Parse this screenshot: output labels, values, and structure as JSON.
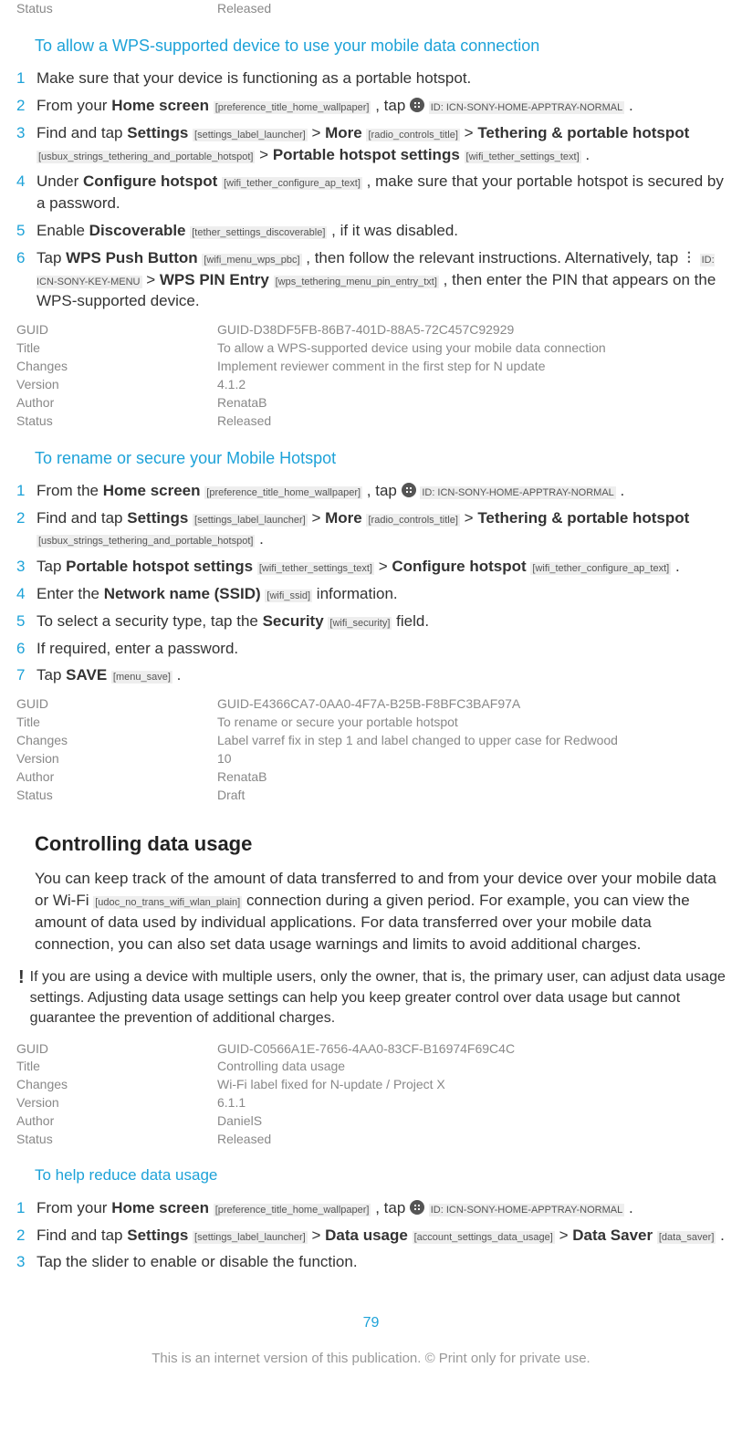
{
  "topmeta": {
    "status_k": "Status",
    "status_v": "Released"
  },
  "sec1": {
    "title": "To allow a WPS-supported device to use your mobile data connection",
    "s1": "Make sure that your device is functioning as a portable hotspot.",
    "s2a": "From your ",
    "s2_home": "Home screen",
    "s2_home_tag": "[preference_title_home_wallpaper]",
    "s2b": " , tap ",
    "s2_icon_tag": "ID: ICN-SONY-HOME-APPTRAY-NORMAL",
    "s2c": " .",
    "s3a": "Find and tap ",
    "s3_settings": "Settings",
    "s3_settings_tag": "[settings_label_launcher]",
    "s3_more": "More",
    "s3_more_tag": "[radio_controls_title]",
    "s3_th": "Tethering & portable hotspot",
    "s3_th_tag": "[usbux_strings_tethering_and_portable_hotspot]",
    "s3_phs": "Portable hotspot settings",
    "s3_phs_tag": "[wifi_tether_settings_text]",
    "s4a": "Under ",
    "s4_cfg": "Configure hotspot",
    "s4_cfg_tag": "[wifi_tether_configure_ap_text]",
    "s4b": " , make sure that your portable hotspot is secured by a password.",
    "s5a": "Enable ",
    "s5_disc": "Discoverable",
    "s5_disc_tag": "[tether_settings_discoverable]",
    "s5b": " , if it was disabled.",
    "s6a": "Tap ",
    "s6_wps": "WPS Push Button",
    "s6_wps_tag": "[wifi_menu_wps_pbc]",
    "s6b": " , then follow the relevant instructions. Alternatively, tap ",
    "s6_icon_tag": "ID: ICN-SONY-KEY-MENU",
    "s6_pin": "WPS PIN Entry",
    "s6_pin_tag": "[wps_tethering_menu_pin_entry_txt]",
    "s6c": " , then enter the PIN that appears on the WPS-supported device."
  },
  "meta1": {
    "guid_k": "GUID",
    "guid_v": "GUID-D38DF5FB-86B7-401D-88A5-72C457C92929",
    "title_k": "Title",
    "title_v": "To allow a WPS-supported device using your mobile data connection",
    "changes_k": "Changes",
    "changes_v": "Implement reviewer comment in the first step for N update",
    "version_k": "Version",
    "version_v": "4.1.2",
    "author_k": "Author",
    "author_v": "RenataB",
    "status_k": "Status",
    "status_v": "Released"
  },
  "sec2": {
    "title": "To rename or secure your Mobile Hotspot",
    "s1a": "From the ",
    "s1_home": "Home screen",
    "s1_home_tag": "[preference_title_home_wallpaper]",
    "s1b": " , tap ",
    "s1_icon_tag": "ID: ICN-SONY-HOME-APPTRAY-NORMAL",
    "s1c": " .",
    "s2a": "Find and tap ",
    "s2_settings": "Settings",
    "s2_settings_tag": "[settings_label_launcher]",
    "s2_more": "More",
    "s2_more_tag": "[radio_controls_title]",
    "s2_th": "Tethering & portable hotspot",
    "s2_th_tag": "[usbux_strings_tethering_and_portable_hotspot]",
    "s3a": "Tap ",
    "s3_phs": "Portable hotspot settings",
    "s3_phs_tag": "[wifi_tether_settings_text]",
    "s3_cfg": "Configure hotspot",
    "s3_cfg_tag": "[wifi_tether_configure_ap_text]",
    "s4a": "Enter the ",
    "s4_ssid": "Network name (SSID)",
    "s4_ssid_tag": "[wifi_ssid]",
    "s4b": " information.",
    "s5a": "To select a security type, tap the ",
    "s5_sec": "Security",
    "s5_sec_tag": "[wifi_security]",
    "s5b": " field.",
    "s6": "If required, enter a password.",
    "s7a": "Tap ",
    "s7_save": "SAVE",
    "s7_save_tag": "[menu_save]"
  },
  "meta2": {
    "guid_k": "GUID",
    "guid_v": "GUID-E4366CA7-0AA0-4F7A-B25B-F8BFC3BAF97A",
    "title_k": "Title",
    "title_v": "To rename or secure your portable hotspot",
    "changes_k": "Changes",
    "changes_v": "Label varref fix in step 1 and label changed to upper case for Redwood",
    "version_k": "Version",
    "version_v": "10",
    "author_k": "Author",
    "author_v": "RenataB",
    "status_k": "Status",
    "status_v": "Draft"
  },
  "sec3": {
    "heading": "Controlling data usage",
    "p1a": "You can keep track of the amount of data transferred to and from your device over your mobile data or Wi-Fi",
    "p1_tag": "[udoc_no_trans_wifi_wlan_plain]",
    "p1b": " connection during a given period. For example, you can view the amount of data used by individual applications. For data transferred over your mobile data connection, you can also set data usage warnings and limits to avoid additional charges.",
    "note": "If you are using a device with multiple users, only the owner, that is, the primary user, can adjust data usage settings. Adjusting data usage settings can help you keep greater control over data usage but cannot guarantee the prevention of additional charges."
  },
  "meta3": {
    "guid_k": "GUID",
    "guid_v": "GUID-C0566A1E-7656-4AA0-83CF-B16974F69C4C",
    "title_k": "Title",
    "title_v": "Controlling data usage",
    "changes_k": "Changes",
    "changes_v": "Wi-Fi label fixed for N-update / Project X",
    "version_k": "Version",
    "version_v": "6.1.1",
    "author_k": "Author",
    "author_v": "DanielS",
    "status_k": "Status",
    "status_v": "Released"
  },
  "sec4": {
    "title": "To help reduce data usage",
    "s1a": "From your ",
    "s1_home": "Home screen",
    "s1_home_tag": "[preference_title_home_wallpaper]",
    "s1b": " , tap ",
    "s1_icon_tag": "ID: ICN-SONY-HOME-APPTRAY-NORMAL",
    "s1c": " .",
    "s2a": "Find and tap ",
    "s2_settings": "Settings",
    "s2_settings_tag": "[settings_label_launcher]",
    "s2_du": "Data usage",
    "s2_du_tag": "[account_settings_data_usage]",
    "s2_ds": "Data Saver",
    "s2_ds_tag": "[data_saver]",
    "s3": "Tap the slider to enable or disable the function."
  },
  "page": "79",
  "footer": "This is an internet version of this publication. © Print only for private use."
}
